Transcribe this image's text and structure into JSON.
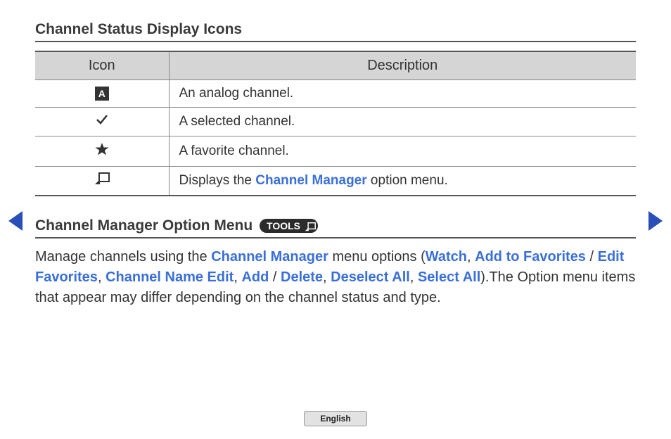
{
  "section1": {
    "title": "Channel Status Display Icons"
  },
  "table": {
    "headers": {
      "icon": "Icon",
      "desc": "Description"
    },
    "rows": [
      {
        "desc_pre": "An analog channel.",
        "ref": "",
        "desc_post": ""
      },
      {
        "desc_pre": "A selected channel.",
        "ref": "",
        "desc_post": ""
      },
      {
        "desc_pre": "A favorite channel.",
        "ref": "",
        "desc_post": ""
      },
      {
        "desc_pre": "Displays the ",
        "ref": "Channel Manager",
        "desc_post": " option menu."
      }
    ]
  },
  "section2": {
    "title": "Channel Manager Option Menu",
    "tools_label": "TOOLS"
  },
  "paragraph": {
    "t1": "Manage channels using the ",
    "r1": "Channel Manager",
    "t2": " menu options (",
    "r2": "Watch",
    "t3": ", ",
    "r3": "Add to Favorites",
    "t4": " / ",
    "r4": "Edit Favorites",
    "t5": ", ",
    "r5": "Channel Name Edit",
    "t6": ", ",
    "r6": "Add",
    "t7": " / ",
    "r7": "Delete",
    "t8": ", ",
    "r8": "Deselect All",
    "t9": ", ",
    "r9": "Select All",
    "t10": ").The Option menu items that appear may differ depending on the channel status and type."
  },
  "footer": {
    "language": "English"
  },
  "icons": {
    "analog_letter": "A"
  }
}
